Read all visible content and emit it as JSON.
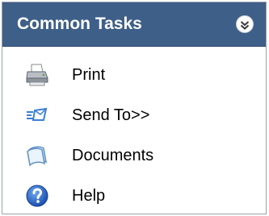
{
  "panel": {
    "title": "Common Tasks",
    "collapse_icon": "chevron-double-up-icon",
    "colors": {
      "header_bg": "#3e5f88",
      "header_text": "#ffffff",
      "border": "#9aa3ad"
    }
  },
  "items": [
    {
      "label": "Print",
      "icon": "printer-icon"
    },
    {
      "label": "Send To>>",
      "icon": "send-to-icon"
    },
    {
      "label": "Documents",
      "icon": "documents-icon"
    },
    {
      "label": "Help",
      "icon": "help-icon"
    }
  ]
}
